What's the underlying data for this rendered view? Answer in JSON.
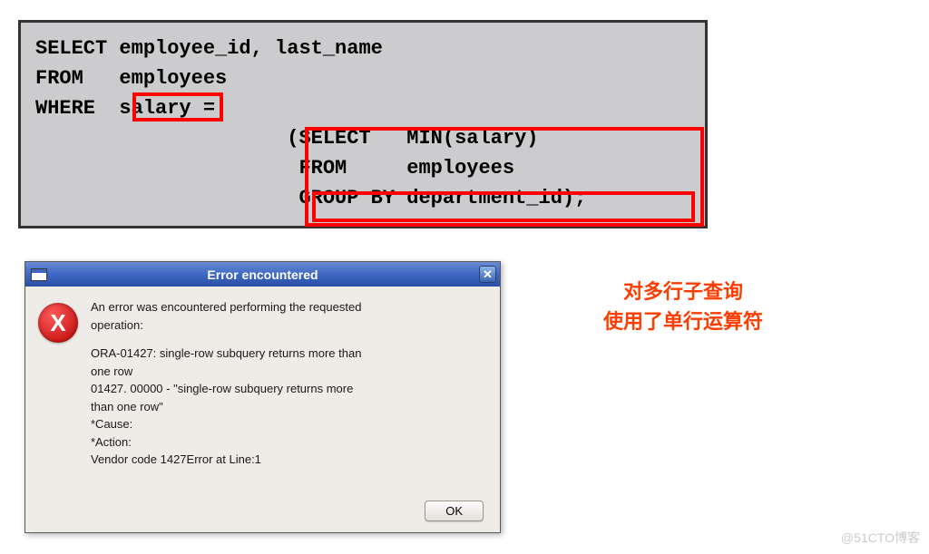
{
  "code": {
    "line1": "SELECT employee_id, last_name",
    "line2": "FROM   employees",
    "line3": "WHERE  salary =",
    "line4": "                     (SELECT   MIN(salary)",
    "line5": "                      FROM     employees",
    "line6": "                      GROUP BY department_id);"
  },
  "dialog": {
    "title": "Error encountered",
    "close_glyph": "✕",
    "icon_glyph": "X",
    "msg1": "An error was encountered performing the requested",
    "msg2": "operation:",
    "err1": "ORA-01427: single-row subquery returns more than",
    "err2": "one row",
    "err3": "01427. 00000 - \"single-row subquery returns more",
    "err4": "than one row\"",
    "cause": "*Cause:",
    "action": "*Action:",
    "vendor": "Vendor code 1427Error at Line:1",
    "ok": "OK"
  },
  "annotation": {
    "line1": "对多行子查询",
    "line2": "使用了单行运算符"
  },
  "watermark": "@51CTO博客"
}
